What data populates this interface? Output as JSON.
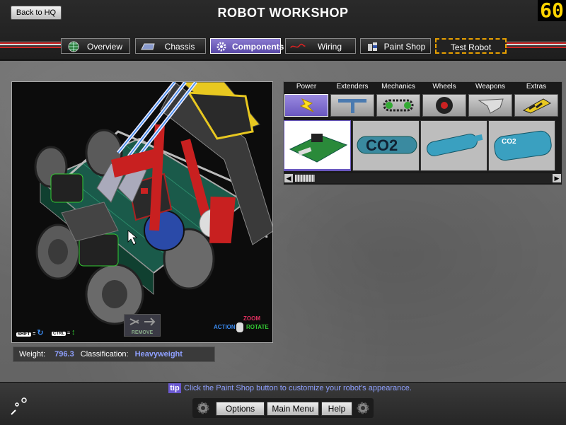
{
  "header": {
    "title": "ROBOT WORKSHOP",
    "back_label": "Back to HQ",
    "counter": "60"
  },
  "tabs": [
    {
      "label": "Overview",
      "icon": "globe-icon",
      "active": false
    },
    {
      "label": "Chassis",
      "icon": "chassis-icon",
      "active": false
    },
    {
      "label": "Components",
      "icon": "gear-icon",
      "active": true
    },
    {
      "label": "Wiring",
      "icon": "wire-icon",
      "active": false
    },
    {
      "label": "Paint Shop",
      "icon": "paint-can-icon",
      "active": false
    },
    {
      "label": "Test Robot",
      "icon": "",
      "active": false
    }
  ],
  "viewport": {
    "shift_key": "SHIFT",
    "ctrl_key": "CTRL",
    "remove_label": "REMOVE",
    "zoom_label": "ZOOM",
    "action_label": "ACTION",
    "rotate_label": "ROTATE"
  },
  "info": {
    "weight_label": "Weight:",
    "weight_value": "796.3",
    "class_label": "Classification:",
    "class_value": "Heavyweight"
  },
  "categories": [
    {
      "label": "Power",
      "icon": "lightning-icon",
      "active": true
    },
    {
      "label": "Extenders",
      "icon": "extender-icon",
      "active": false
    },
    {
      "label": "Mechanics",
      "icon": "chain-icon",
      "active": false
    },
    {
      "label": "Wheels",
      "icon": "wheel-icon",
      "active": false
    },
    {
      "label": "Weapons",
      "icon": "weapon-icon",
      "active": false
    },
    {
      "label": "Extras",
      "icon": "extras-icon",
      "active": false
    }
  ],
  "items": [
    {
      "icon": "circuit-board-icon",
      "label": ""
    },
    {
      "icon": "co2-cartridge-icon",
      "label": "CO2"
    },
    {
      "icon": "co2-tank-icon",
      "label": ""
    },
    {
      "icon": "co2-tank-large-icon",
      "label": "CO2"
    }
  ],
  "tip": {
    "badge": "tip",
    "text": "Click the Paint Shop button to customize your robot's appearance."
  },
  "footer": {
    "options": "Options",
    "main_menu": "Main Menu",
    "help": "Help"
  },
  "colors": {
    "accent": "#6a58c0",
    "counter": "#ffd400",
    "value": "#8fa0ff"
  }
}
